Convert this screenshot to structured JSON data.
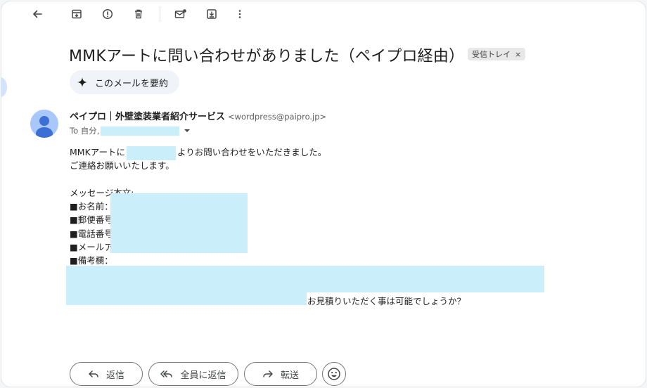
{
  "toolbar": {
    "back_icon": "arrow-left-icon",
    "archive_icon": "archive-icon",
    "spam_icon": "report-spam-icon",
    "delete_icon": "trash-icon",
    "unread_icon": "mark-unread-icon",
    "move_icon": "move-to-icon",
    "more_icon": "more-vert-icon"
  },
  "email": {
    "subject": "MMKアートに問い合わせがありました（ペイプロ経由）",
    "label": "受信トレイ",
    "label_close": "×",
    "summarize_label": "このメールを要約",
    "sender_name": "ペイプロ｜外壁塗装業者紹介サービス",
    "sender_email": "<wordpress@paipro.jp>",
    "to_prefix": "To 自分,",
    "body": {
      "line1_prefix": "MMKアートに",
      "line1_suffix": "よりお問い合わせをいただきました。",
      "line2": "ご連絡お願いいたします。",
      "message_header": "メッセージ本文:",
      "field_name": "■お名前：",
      "field_postal": "■郵便番号",
      "field_phone": "■電話番号",
      "field_email": "■メールア",
      "field_notes": "■備考欄：",
      "notes_end": "お見積りいただく事は可能でしょうか？"
    }
  },
  "actions": {
    "reply": "返信",
    "reply_all": "全員に返信",
    "forward": "転送"
  },
  "colors": {
    "redaction": "#cbeefb",
    "avatar_bg": "#a8c7fa",
    "avatar_fg": "#3b6fd6"
  }
}
